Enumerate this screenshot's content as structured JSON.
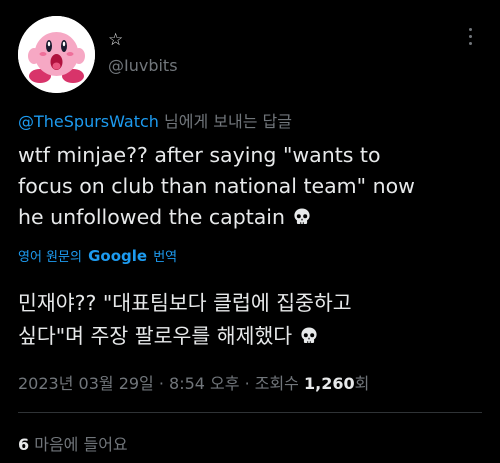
{
  "author": {
    "display_name": "☆",
    "handle": "@Iuvbits",
    "avatar_icon": "kirby-avatar-icon"
  },
  "reply": {
    "mention": "@TheSpursWatch",
    "suffix": "님에게 보내는 답글"
  },
  "tweet": {
    "lines": [
      "wtf minjae?? after saying \"wants to",
      "focus on club than national team\" now",
      "he unfollowed the captain"
    ],
    "emoji": "skull-icon"
  },
  "translation": {
    "prefix": "영어 원문의",
    "brand": "Google",
    "suffix": "번역",
    "lines": [
      "민재야?? \"대표팀보다 클럽에 집중하고",
      "싶다\"며 주장 팔로우를 해제했다"
    ]
  },
  "meta": {
    "timestamp": "2023년 03월 29일 · 8:54 오후 · 조회수",
    "views": "1,260",
    "views_suffix": "회"
  },
  "stats": {
    "likes_count": "6",
    "likes_label": "마음에 들어요"
  },
  "colors": {
    "background": "#000000",
    "text": "#e7e9ea",
    "muted": "#71767b",
    "accent": "#1d9bf0"
  }
}
